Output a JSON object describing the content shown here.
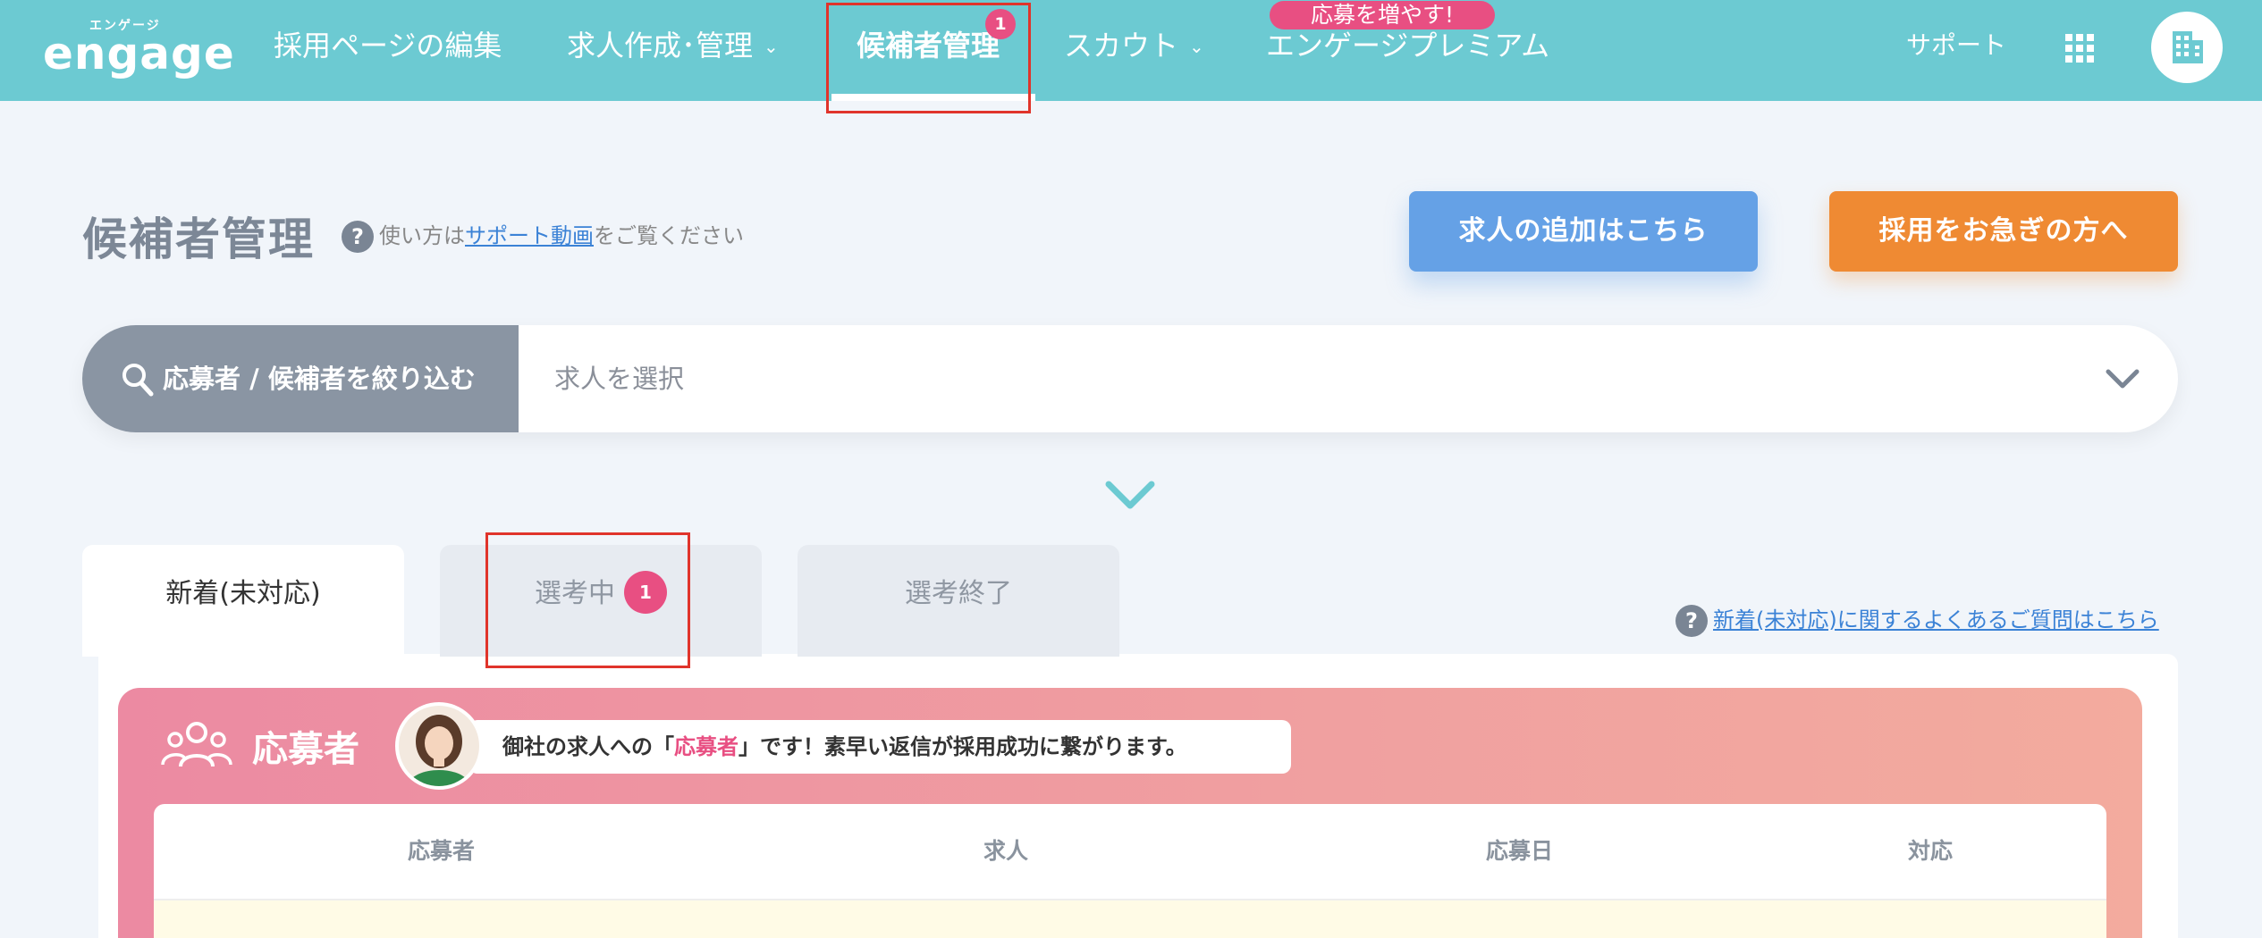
{
  "header": {
    "logo_kana": "エンゲージ",
    "logo_text": "engage",
    "nav": [
      {
        "label": "採用ページの編集"
      },
      {
        "label": "求人作成･管理"
      },
      {
        "label": "候補者管理",
        "badge": "1"
      },
      {
        "label": "スカウト"
      },
      {
        "label": "エンゲージプレミアム",
        "promo": "応募を増やす!"
      }
    ],
    "support_label": "サポート"
  },
  "page": {
    "title": "候補者管理",
    "help_prefix": "使い方は",
    "help_link": "サポート動画",
    "help_suffix": "をご覧ください",
    "help_icon": "?",
    "add_job_button": "求人の追加はこちら",
    "urgent_button": "採用をお急ぎの方へ"
  },
  "filter": {
    "label": "応募者 / 候補者を絞り込む",
    "select_placeholder": "求人を選択"
  },
  "tabs": [
    {
      "label": "新着(未対応)"
    },
    {
      "label": "選考中",
      "badge": "1"
    },
    {
      "label": "選考終了"
    }
  ],
  "faq": {
    "icon": "?",
    "link": "新着(未対応)に関するよくあるご質問はこちら"
  },
  "panel": {
    "title": "応募者",
    "message_prefix": "御社の求人への「",
    "message_highlight": "応募者",
    "message_suffix": "」です！素早い返信が採用成功に繋がります。"
  },
  "table": {
    "columns": [
      "応募者",
      "求人",
      "応募日",
      "対応"
    ]
  },
  "colors": {
    "header_bg": "#6ccad2",
    "badge_pink": "#e84f82",
    "button_blue": "#65a1e6",
    "button_orange": "#ef8a33",
    "highlight_red": "#e0342b"
  }
}
